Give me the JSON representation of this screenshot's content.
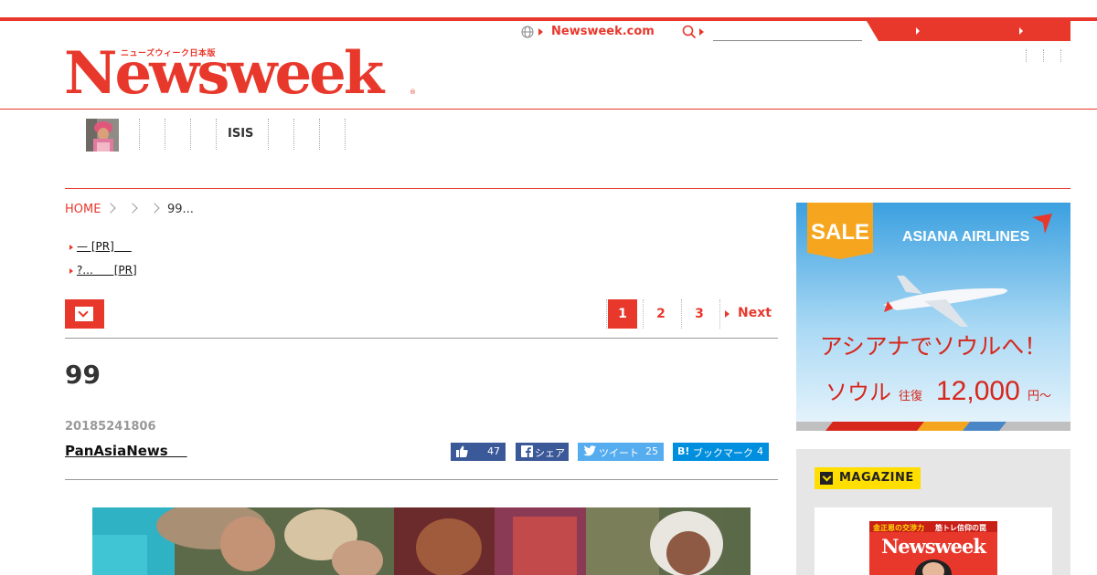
{
  "header": {
    "logo_text": "Newsweek",
    "logo_subtitle": "ニューズウィーク日本版",
    "logo_reg": "®",
    "site_link": "Newsweek.com",
    "search_placeholder": ""
  },
  "nav": {
    "isis_label": "ISIS"
  },
  "breadcrumb": {
    "home": "HOME",
    "current": "99..."
  },
  "pr_links": [
    "— [PR]     ",
    "?...      [PR]"
  ],
  "pagination": {
    "pages": [
      "1",
      "2",
      "3"
    ],
    "active": "1",
    "next": "Next"
  },
  "article": {
    "title": "99",
    "date": "20185241806",
    "author": "PanAsiaNews    "
  },
  "share": {
    "like_count": "47",
    "facebook_label": "シェア",
    "twitter_label": "ツイート",
    "twitter_count": "25",
    "hatena_label": "ブックマーク",
    "hatena_count": "4"
  },
  "ad": {
    "sale": "SALE",
    "airline": "ASIANA AIRLINES",
    "headline": "アシアナでソウルへ！",
    "route": "ソウル",
    "roundtrip": "往復",
    "price": "12,000",
    "price_unit": "円〜"
  },
  "magazine": {
    "badge": "MAGAZINE",
    "cover_title": "Newsweek",
    "cover_tag1": "金正恩の交渉力",
    "cover_tag2": "筋トレ信仰の罠"
  },
  "colors": {
    "brand": "#e8382c",
    "facebook": "#3b5998",
    "twitter": "#55acee",
    "hatena": "#008fde",
    "magazine_badge": "#ffde00"
  }
}
